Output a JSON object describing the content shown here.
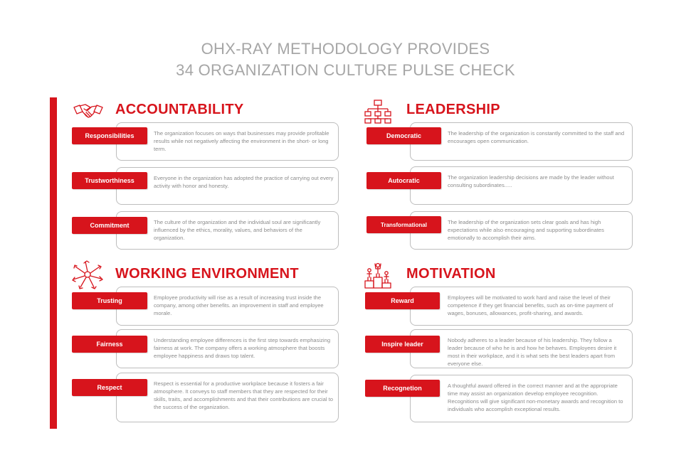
{
  "title": {
    "line1": "OHX-RAY METHODOLOGY PROVIDES",
    "line2": "34 ORGANIZATION CULTURE PULSE CHECK"
  },
  "colors": {
    "accent": "#d7141c",
    "muted_text": "#8c8c8c",
    "title_gray": "#a6a6a6"
  },
  "sections": {
    "accountability": {
      "title": "ACCOUNTABILITY",
      "icon": "handshake-icon",
      "items": [
        {
          "label": "Responsibilities",
          "text": "The organization focuses on ways that businesses may provide profitable results while not negatively affecting the environment in the short- or long term."
        },
        {
          "label": "Trustworthiness",
          "text": "Everyone in the organization has adopted the practice of carrying out every activity with honor and honesty."
        },
        {
          "label": "Commitment",
          "text": "The culture of the organization and the individual soul are significantly influenced by the ethics, morality, values, and behaviors of the organization."
        }
      ]
    },
    "leadership": {
      "title": "LEADERSHIP",
      "icon": "org-chart-icon",
      "items": [
        {
          "label": "Democratic",
          "text": "The leadership of the organization is constantly committed to the staff and encourages open communication."
        },
        {
          "label": "Autocratic",
          "text": "The organization leadership decisions are made by the  leader without consulting subordinates....."
        },
        {
          "label": "Transformational",
          "text": "The leadership of the organization sets clear goals and has high expectations while also encouraging and supporting subordinates emotionally to accomplish their aims."
        }
      ]
    },
    "working": {
      "title": "WORKING ENVIRONMENT",
      "icon": "team-hands-icon",
      "items": [
        {
          "label": "Trusting",
          "text": "Employee productivity will rise as a result of increasing trust inside the company, among other benefits. an improvement in staff and employee morale."
        },
        {
          "label": "Fairness",
          "text": "Understanding employee differences is the first step towards emphasizing fairness at work. The company offers a working atmosphere that boosts employee happiness and draws top talent."
        },
        {
          "label": "Respect",
          "text": "Respect is essential for a productive workplace because it fosters a fair atmosphere. It conveys to staff members that they are respected for their skills, traits, and accomplishments and that their contributions are crucial to the success of the organization."
        }
      ]
    },
    "motivation": {
      "title": "MOTIVATION",
      "icon": "podium-icon",
      "items": [
        {
          "label": "Reward",
          "text": "Employees will be motivated to work hard and raise the level of their competence if they get financial benefits, such as on-time payment of wages, bonuses, allowances, profit-sharing, and awards."
        },
        {
          "label": "Inspire leader",
          "text": "Nobody adheres to a leader because of his leadership. They follow a leader because of who he is and how he behaves. Employees desire it most in their workplace, and it is what sets the best leaders apart from everyone else."
        },
        {
          "label": "Recognetion",
          "text": "A thoughtful award offered in the correct manner and at the appropriate time may assist an organization develop employee recognition. Recognitions will give significant non-monetary awards and recognition to individuals who accomplish exceptional results."
        }
      ]
    }
  }
}
